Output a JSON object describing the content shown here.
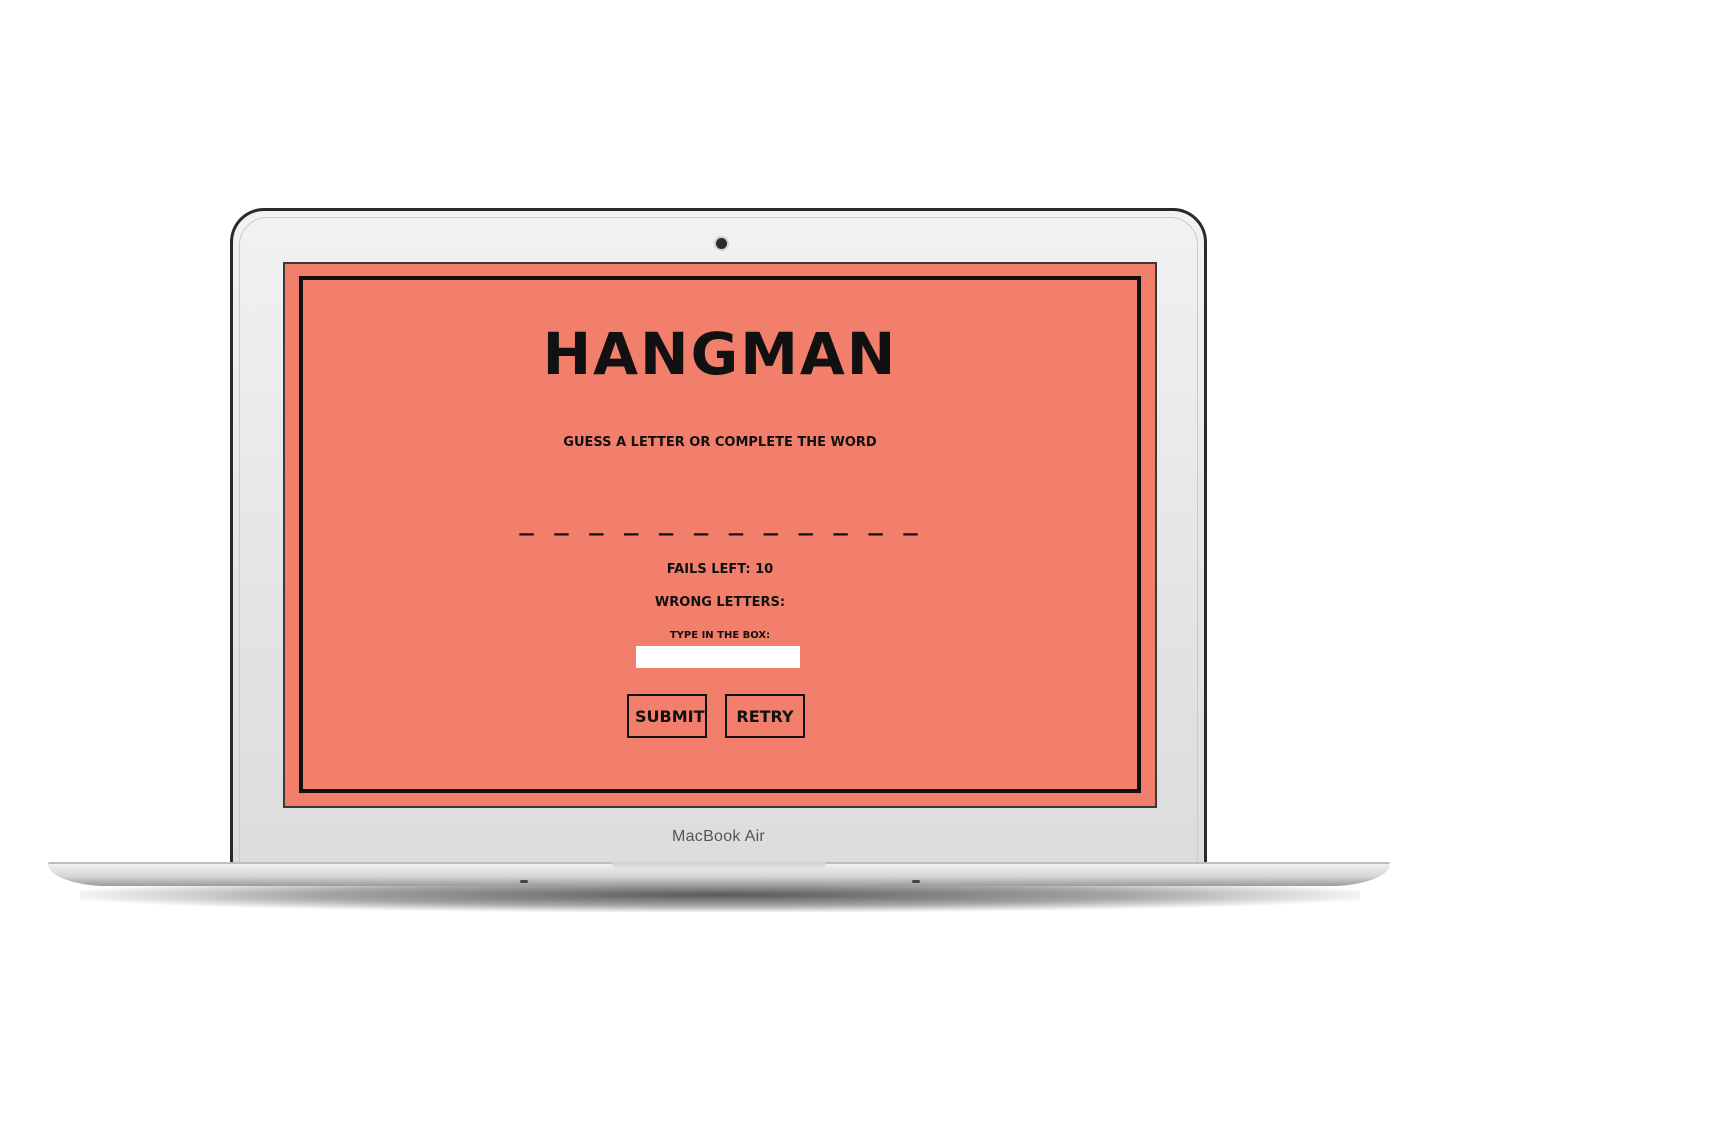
{
  "device": {
    "label": "MacBook Air"
  },
  "game": {
    "title": "HANGMAN",
    "instruction": "Guess a letter or complete the word",
    "word_slots": "_ _ _ _ _ _ _ _ _ _ _ _",
    "fails_text": "Fails left: 10",
    "wrong_letters_text": "Wrong letters:",
    "input_label": "Type in the box:",
    "input_value": "",
    "submit_label": "Submit",
    "retry_label": "Retry"
  },
  "colors": {
    "screen_background": "#f17f6b",
    "text": "#111111",
    "input_background": "#ffffff"
  }
}
